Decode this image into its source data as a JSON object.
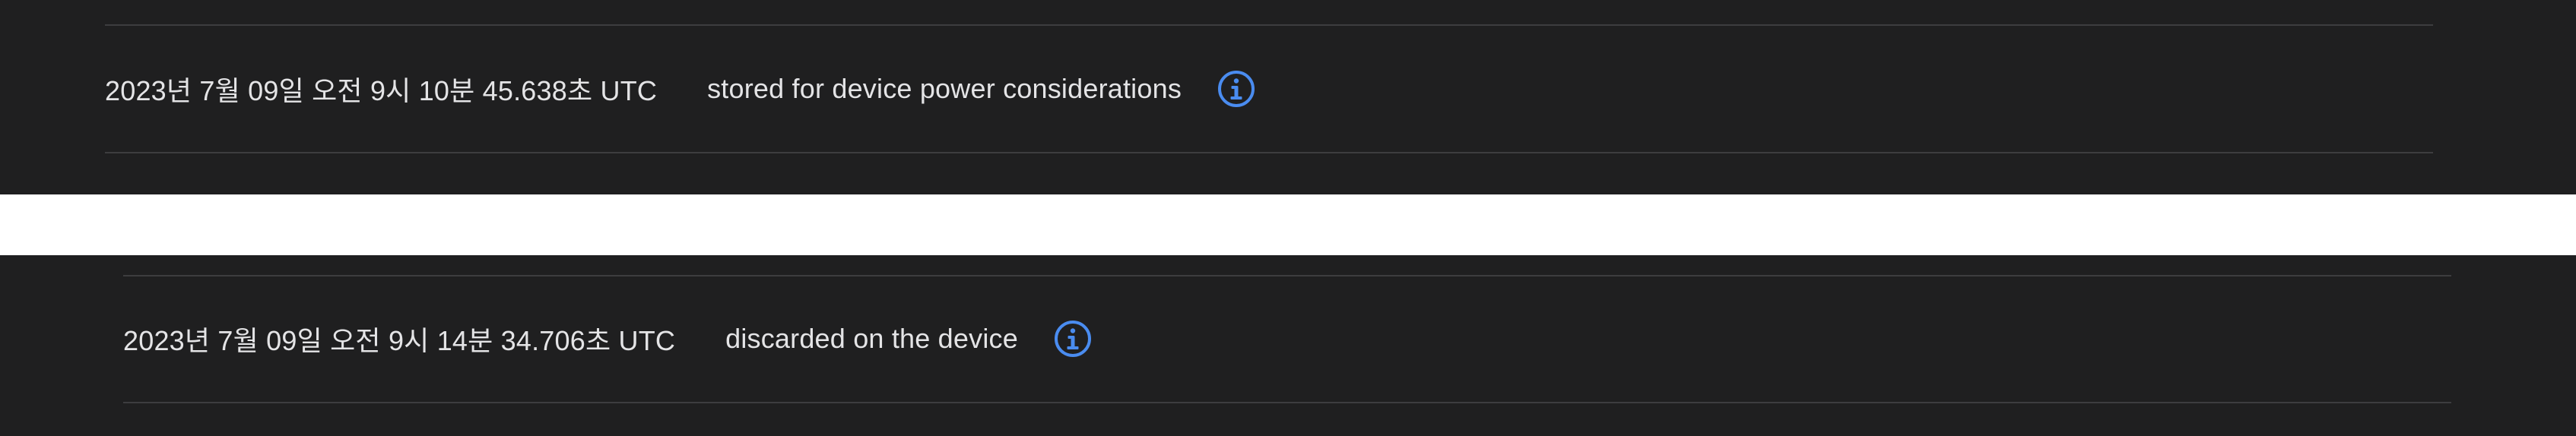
{
  "entries": [
    {
      "timestamp": "2023년 7월 09일 오전 9시 10분 45.638초 UTC",
      "status": "stored for device power considerations",
      "icon": "info-icon"
    },
    {
      "timestamp": "2023년 7월 09일 오전 9시 14분 34.706초 UTC",
      "status": "discarded on the device",
      "icon": "info-icon"
    }
  ],
  "colors": {
    "panel_background": "#1f1f20",
    "separator_band": "#ffffff",
    "divider": "#3d3d3f",
    "text": "#e4e4e6",
    "icon_accent": "#4a8cf0"
  }
}
